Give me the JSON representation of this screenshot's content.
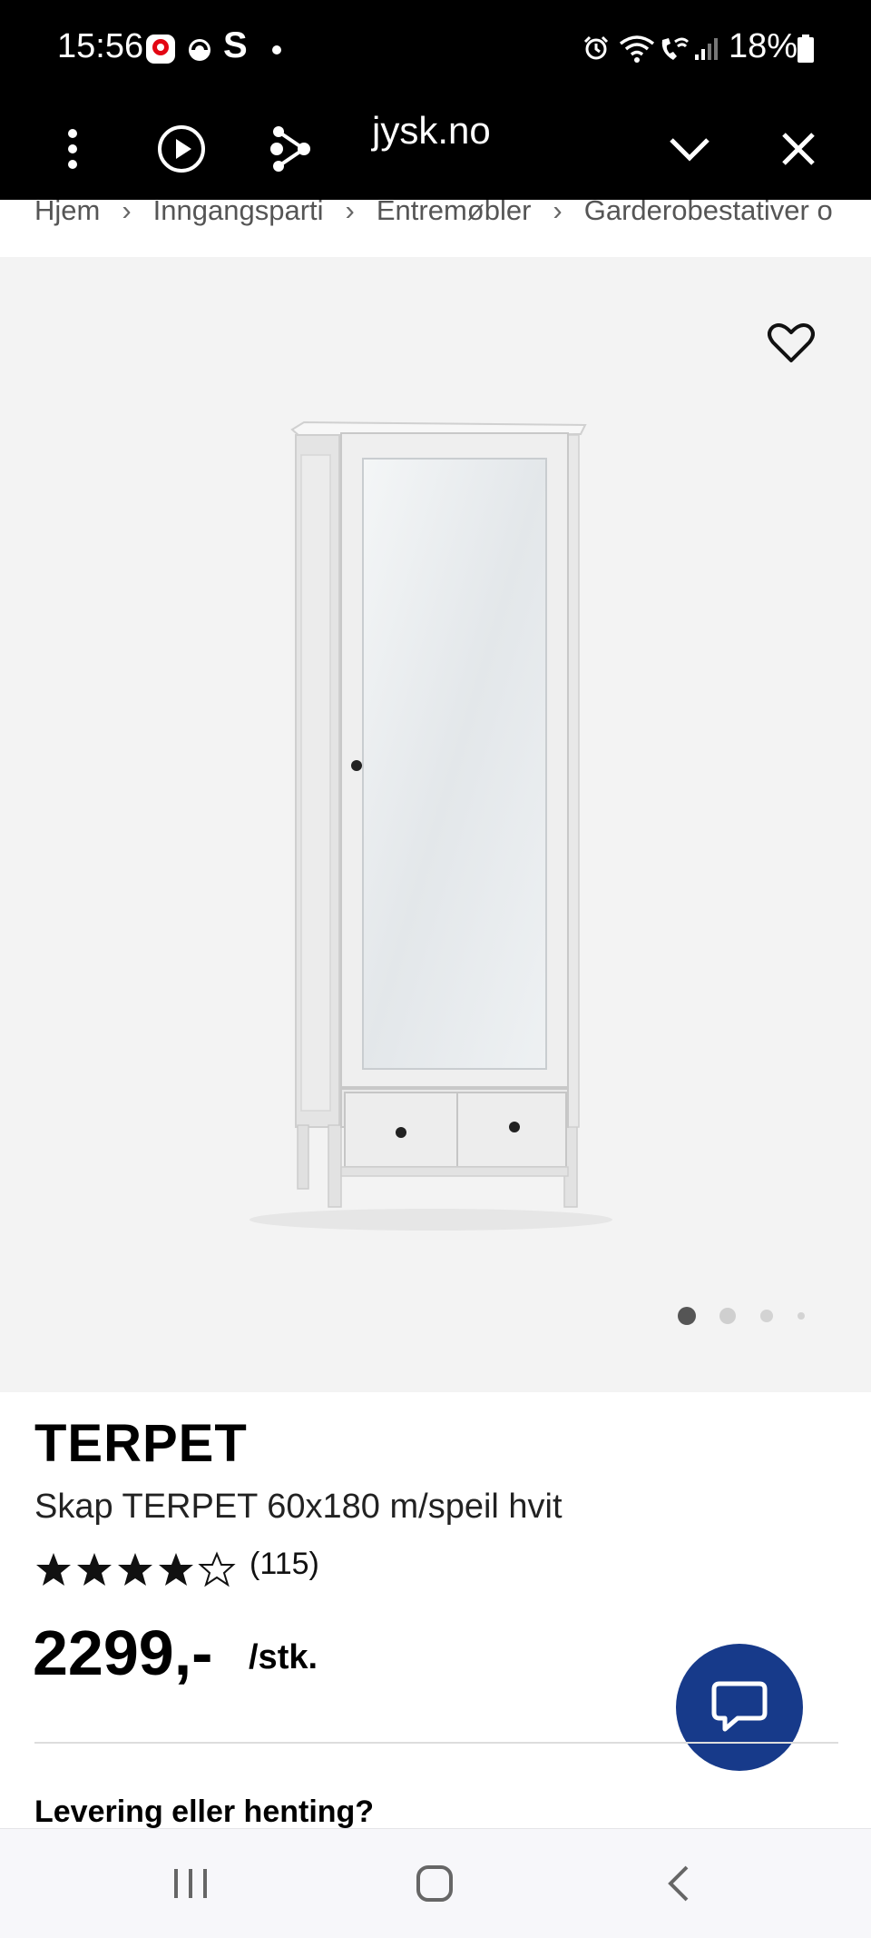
{
  "status_bar": {
    "time": "15:56",
    "battery": "18%",
    "icons": [
      "posten-icon",
      "sync-icon",
      "s-app-icon",
      "alarm-icon",
      "wifi-icon",
      "wifi-call-icon",
      "signal-icon",
      "battery-icon"
    ]
  },
  "browser": {
    "url": "jysk.no",
    "buttons": [
      "menu-icon",
      "play-icon",
      "share-icon",
      "chevron-down-icon",
      "close-icon"
    ]
  },
  "breadcrumb": [
    "Hjem",
    "Inngangsparti",
    "Entremøbler",
    "Garderobestativer o"
  ],
  "product": {
    "brand": "TERPET",
    "name": "Skap TERPET 60x180 m/speil hvit",
    "rating": 4,
    "rating_max": 5,
    "reviews": "(115)",
    "price": "2299,-",
    "unit": "/stk.",
    "gallery_index": 1,
    "gallery_count": 4
  },
  "delivery_heading": "Levering eller henting?",
  "colors": {
    "chat_button": "#173a8a",
    "gallery_bg": "#f3f3f3",
    "topbar": "#000000"
  }
}
